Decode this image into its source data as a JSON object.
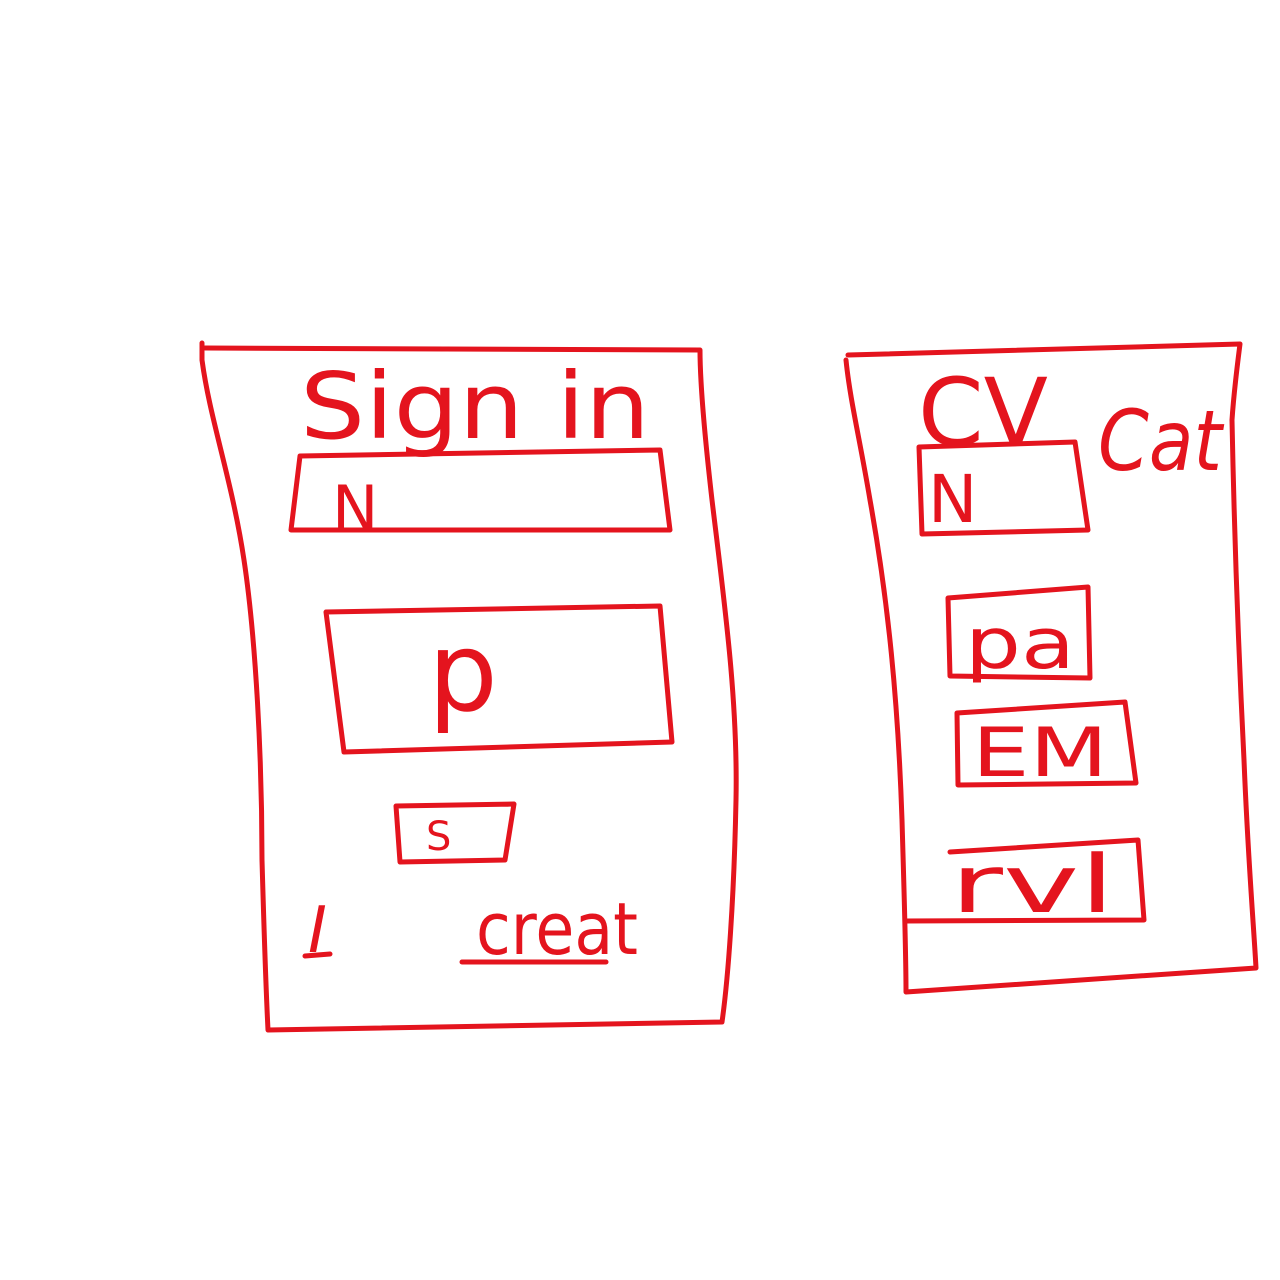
{
  "colors": {
    "ink": "#e4141e",
    "background": "#ffffff"
  },
  "signin": {
    "title": "Sign in",
    "name_field": "N",
    "password_field": "p",
    "submit_button": "S",
    "left_link": "I",
    "create_link": "creat"
  },
  "create_account": {
    "title": "CV",
    "side_note": "Cat",
    "name_field": "N",
    "password_field": "pa",
    "email_field": "EM",
    "submit_button": "rvl"
  }
}
